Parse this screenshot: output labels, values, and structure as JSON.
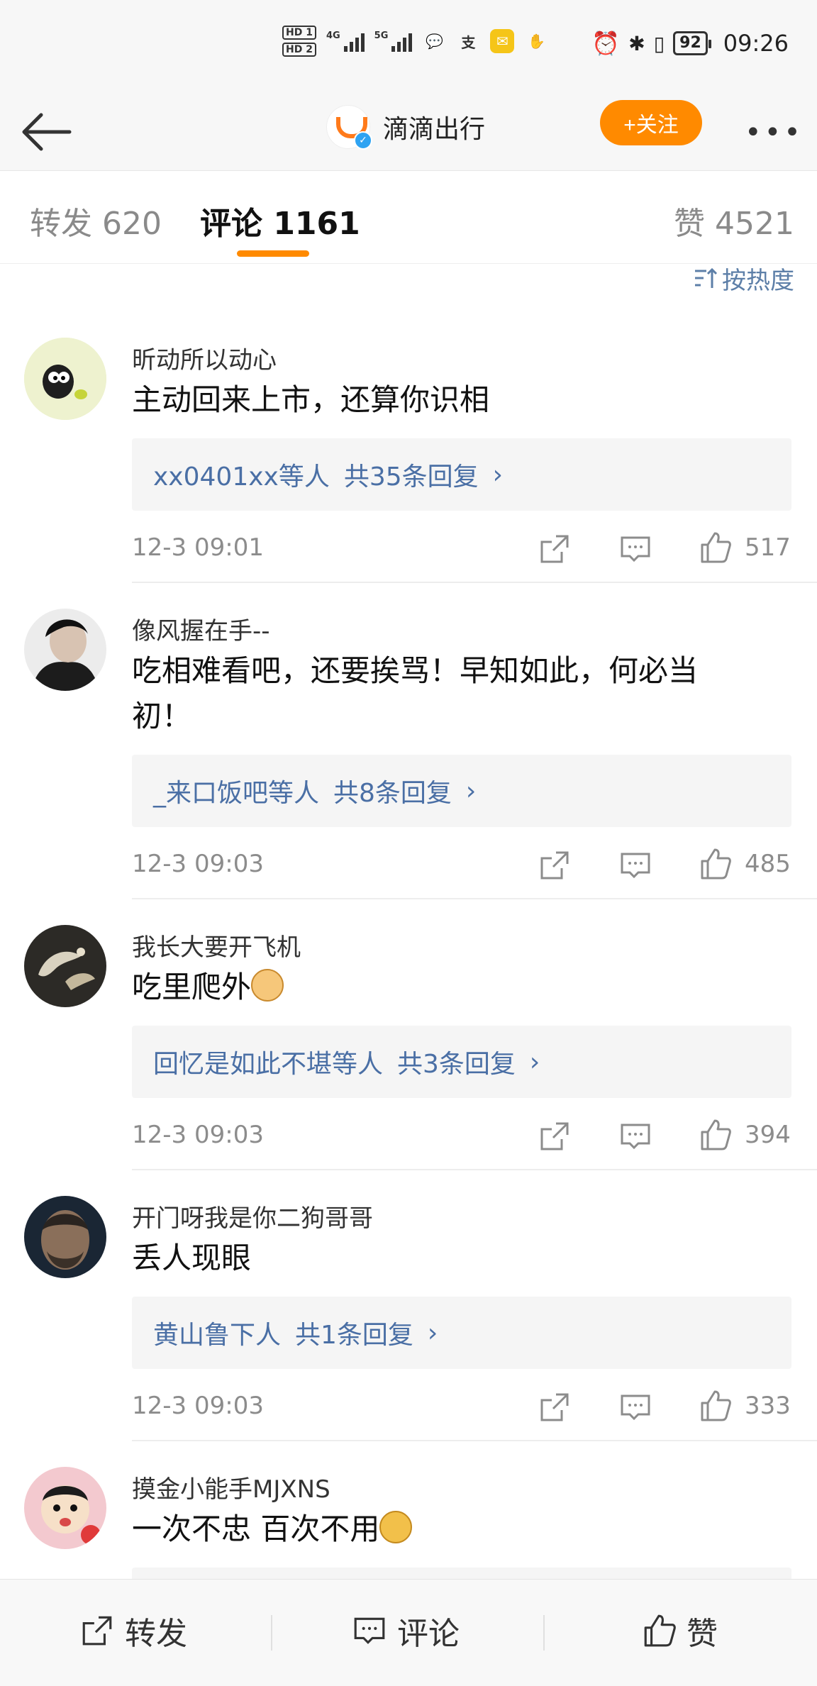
{
  "status_bar": {
    "hd1": "HD 1",
    "hd2": "HD 2",
    "net1": "4G",
    "net2": "5G",
    "battery": "92",
    "time": "09:26"
  },
  "nav": {
    "title": "滴滴出行",
    "follow_label": "+关注",
    "more": "•••"
  },
  "tabs": {
    "repost": "转发 620",
    "comments": "评论 1161",
    "likes": "赞 4521"
  },
  "sort_label": "按热度",
  "comments": [
    {
      "user": "昕动所以动心",
      "text": "主动回来上市，还算你识相",
      "reply_users": "xx0401xx等人",
      "reply_count": "共35条回复",
      "time": "12-3 09:01",
      "likes": "517"
    },
    {
      "user": "像风握在手--",
      "text": "吃相难看吧，还要挨骂！早知如此，何必当初！",
      "reply_users": "_来口饭吧等人",
      "reply_count": "共8条回复",
      "time": "12-3 09:03",
      "likes": "485"
    },
    {
      "user": "我长大要开飞机",
      "text": "吃里爬外",
      "reply_users": "回忆是如此不堪等人",
      "reply_count": "共3条回复",
      "time": "12-3 09:03",
      "likes": "394"
    },
    {
      "user": "开门呀我是你二狗哥哥",
      "text": "丢人现眼",
      "reply_users": "黄山鲁下人",
      "reply_count": "共1条回复",
      "time": "12-3 09:03",
      "likes": "333"
    },
    {
      "user": "摸金小能手MJXNS",
      "text": "一次不忠 百次不用"
    }
  ],
  "bottom_bar": {
    "repost": "转发",
    "comment": "评论",
    "like": "赞"
  },
  "colors": {
    "accent": "#ff8a00",
    "link": "#4a6fa5"
  }
}
